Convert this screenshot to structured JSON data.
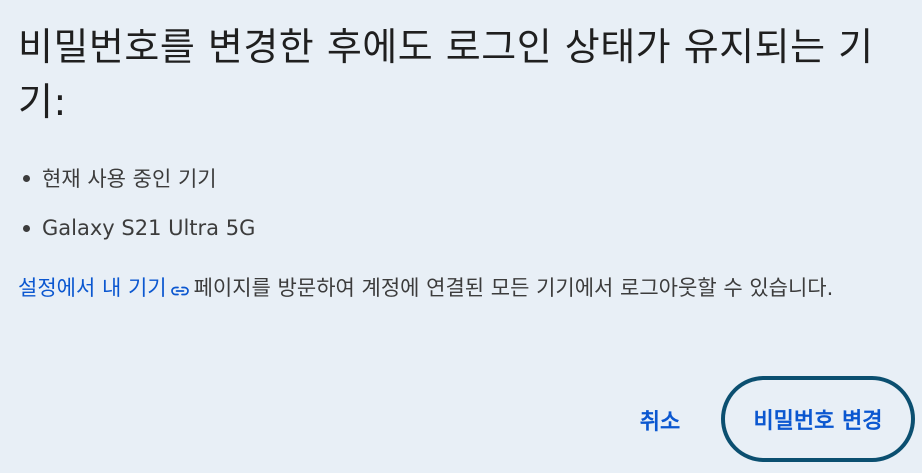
{
  "dialog": {
    "title": "비밀번호를 변경한 후에도 로그인 상태가 유지되는 기기:",
    "devices": [
      {
        "label": "현재 사용 중인 기기"
      },
      {
        "label": "Galaxy S21 Ultra 5G"
      }
    ],
    "info": {
      "link_text": "설정에서 내 기기",
      "link_icon": "link-icon",
      "body_text": "페이지를 방문하여 계정에 연결된 모든 기기에서 로그아웃할 수 있습니다."
    },
    "actions": {
      "cancel_label": "취소",
      "confirm_label": "비밀번호 변경"
    }
  }
}
